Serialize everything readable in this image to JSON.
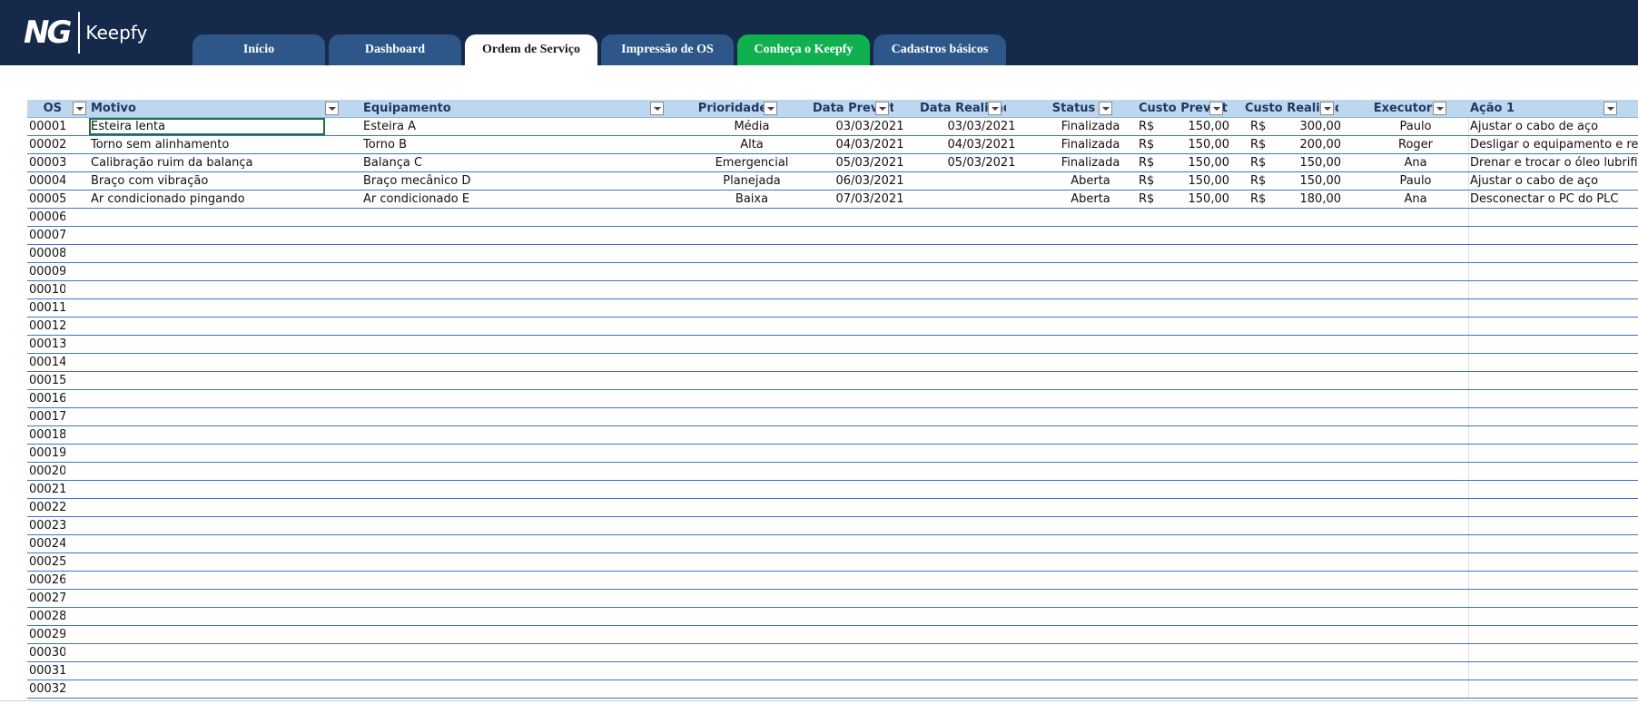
{
  "app": {
    "logo_mark": "NG",
    "logo_text": "Keepfy"
  },
  "tabs": [
    {
      "label": "Início",
      "state": "normal"
    },
    {
      "label": "Dashboard",
      "state": "normal"
    },
    {
      "label": "Ordem de Serviço",
      "state": "active"
    },
    {
      "label": "Impressão de OS",
      "state": "normal"
    },
    {
      "label": "Conheça o Keepfy",
      "state": "highlight"
    },
    {
      "label": "Cadastros básicos",
      "state": "normal"
    }
  ],
  "colors": {
    "header_bg": "#15294a",
    "tab_bg": "#2c5788",
    "tab_green": "#10b050",
    "table_header_bg": "#bdd7ee",
    "row_border": "#4472c4"
  },
  "table": {
    "columns": [
      "OS",
      "Motivo",
      "Equipamento",
      "Prioridade",
      "Data Prevista",
      "Data Realizada",
      "Status",
      "Custo Previsto",
      "Custo Realizado",
      "Executor",
      "Ação 1"
    ],
    "currency": "R$",
    "rows": [
      {
        "os": "00001",
        "motivo": "Esteira lenta",
        "equipamento": "Esteira A",
        "prioridade": "Média",
        "data_prevista": "03/03/2021",
        "data_realizada": "03/03/2021",
        "status": "Finalizada",
        "custo_previsto": "150,00",
        "custo_realizado": "300,00",
        "executor": "Paulo",
        "acao1": "Ajustar o cabo de aço"
      },
      {
        "os": "00002",
        "motivo": "Torno sem alinhamento",
        "equipamento": "Torno B",
        "prioridade": "Alta",
        "data_prevista": "04/03/2021",
        "data_realizada": "04/03/2021",
        "status": "Finalizada",
        "custo_previsto": "150,00",
        "custo_realizado": "200,00",
        "executor": "Roger",
        "acao1": "Desligar o equipamento e recalibrar"
      },
      {
        "os": "00003",
        "motivo": "Calibração ruim da balança",
        "equipamento": "Balança C",
        "prioridade": "Emergencial",
        "data_prevista": "05/03/2021",
        "data_realizada": "05/03/2021",
        "status": "Finalizada",
        "custo_previsto": "150,00",
        "custo_realizado": "150,00",
        "executor": "Ana",
        "acao1": "Drenar e trocar o óleo lubrificante"
      },
      {
        "os": "00004",
        "motivo": "Braço com vibração",
        "equipamento": "Braço mecânico D",
        "prioridade": "Planejada",
        "data_prevista": "06/03/2021",
        "data_realizada": "",
        "status": "Aberta",
        "custo_previsto": "150,00",
        "custo_realizado": "150,00",
        "executor": "Paulo",
        "acao1": "Ajustar o cabo de aço"
      },
      {
        "os": "00005",
        "motivo": "Ar condicionado pingando",
        "equipamento": "Ar condicionado E",
        "prioridade": "Baixa",
        "data_prevista": "07/03/2021",
        "data_realizada": "",
        "status": "Aberta",
        "custo_previsto": "150,00",
        "custo_realizado": "180,00",
        "executor": "Ana",
        "acao1": "Desconectar o PC do PLC"
      }
    ],
    "empty_rows": [
      "00006",
      "00007",
      "00008",
      "00009",
      "00010",
      "00011",
      "00012",
      "00013",
      "00014",
      "00015",
      "00016",
      "00017",
      "00018",
      "00019",
      "00020",
      "00021",
      "00022",
      "00023",
      "00024",
      "00025",
      "00026",
      "00027",
      "00028",
      "00029",
      "00030",
      "00031",
      "00032"
    ]
  }
}
